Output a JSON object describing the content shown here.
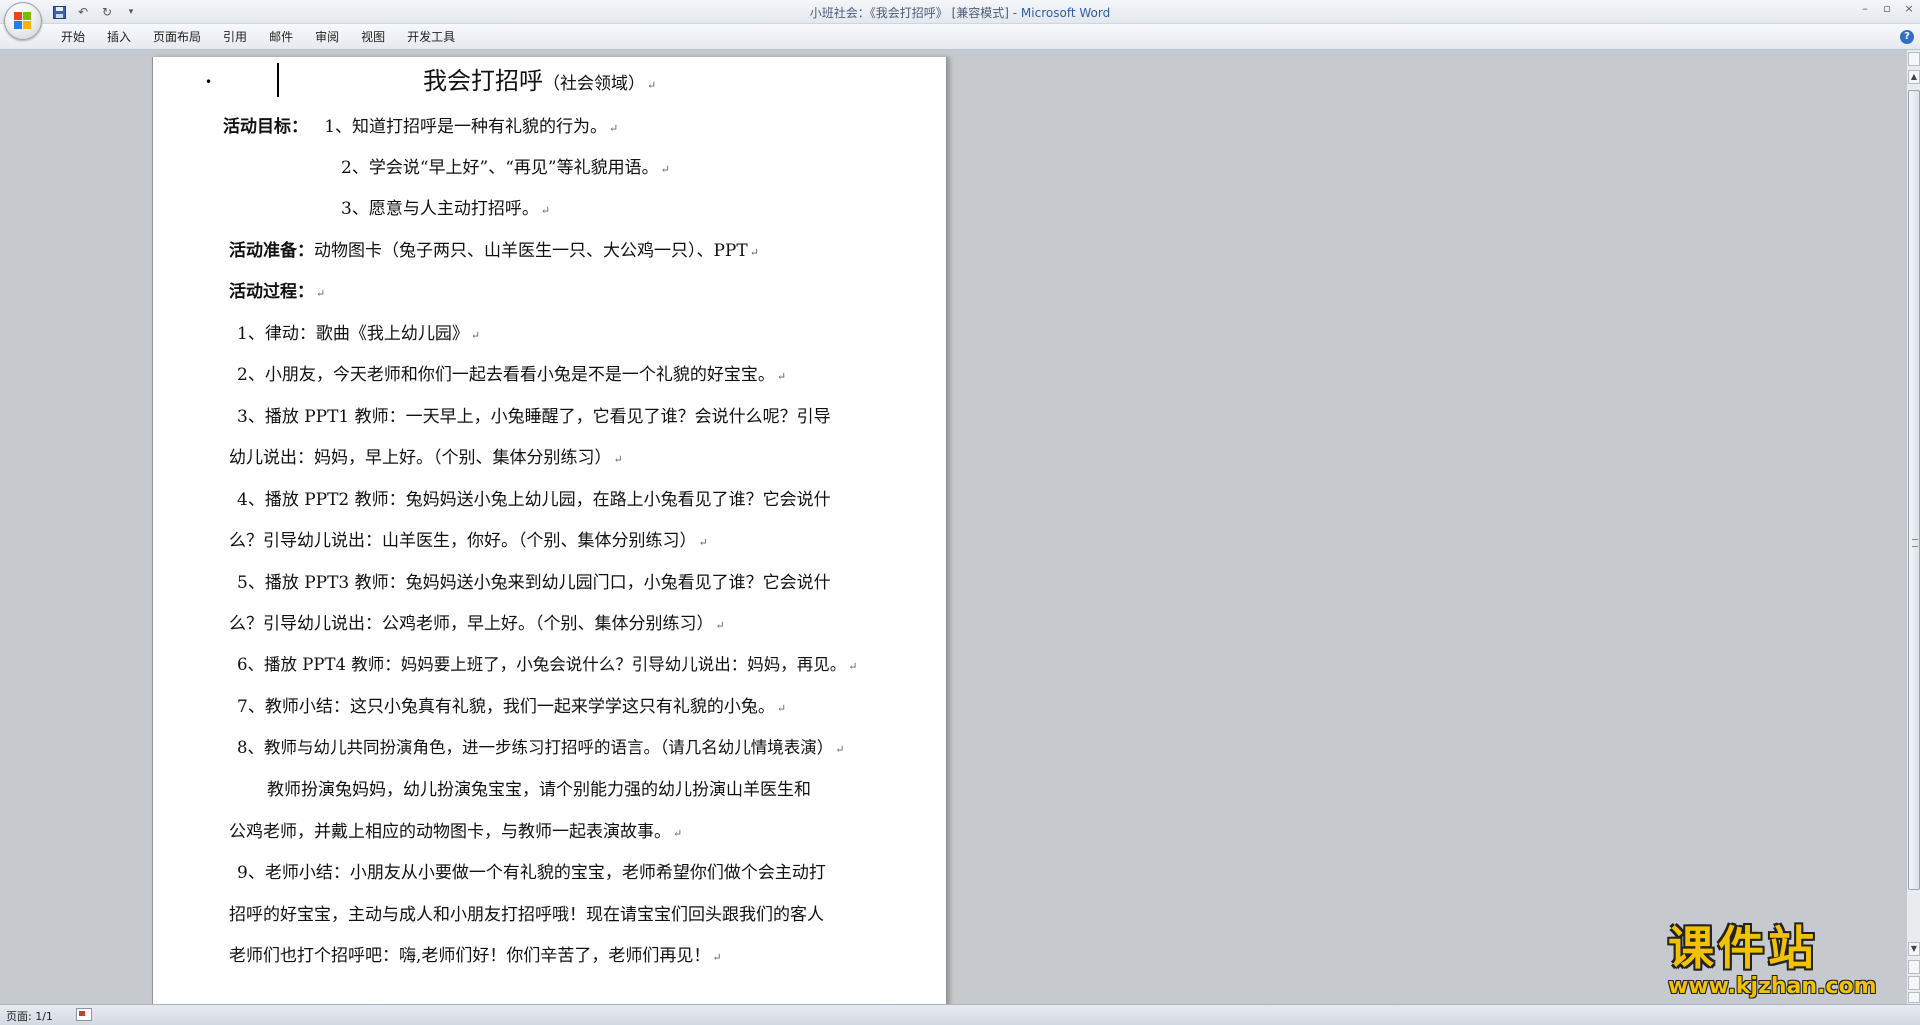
{
  "window": {
    "title_doc": "小班社会：《我会打招呼》 [兼容模式] - ",
    "title_app": "Microsoft Word",
    "controls": [
      "–",
      "▫",
      "×"
    ]
  },
  "qat": {
    "undo": "↶",
    "redo": "↻",
    "dropdown": "▾"
  },
  "ribbon": {
    "tabs": [
      "开始",
      "插入",
      "页面布局",
      "引用",
      "邮件",
      "审阅",
      "视图",
      "开发工具"
    ],
    "help": "?"
  },
  "document": {
    "title": "我会打招呼",
    "title_sub": "（社会领域）",
    "bullet": "•",
    "para_mark": "↵",
    "goals_label": "活动目标：",
    "goals": [
      "1、知道打招呼是一种有礼貌的行为。",
      "2、学会说“早上好”、“再见”等礼貌用语。",
      "3、愿意与人主动打招呼。"
    ],
    "prep_label": "活动准备：",
    "prep_text": "动物图卡（兔子两只、山羊医生一只、大公鸡一只）、PPT",
    "process_label": "活动过程：",
    "lines": [
      "1、律动：歌曲《我上幼儿园》",
      "2、小朋友，今天老师和你们一起去看看小兔是不是一个礼貌的好宝宝。",
      "3、播放 PPT1 教师：一天早上，小兔睡醒了，它看见了谁？会说什么呢？引导",
      "幼儿说出：妈妈，早上好。（个别、集体分别练习）",
      "4、播放 PPT2 教师：兔妈妈送小兔上幼儿园，在路上小兔看见了谁？它会说什",
      "么？引导幼儿说出：山羊医生，你好。（个别、集体分别练习）",
      "5、播放 PPT3 教师：兔妈妈送小兔来到幼儿园门口，小兔看见了谁？它会说什",
      "么？引导幼儿说出：公鸡老师，早上好。（个别、集体分别练习）",
      "6、播放 PPT4 教师：妈妈要上班了，小兔会说什么？引导幼儿说出：妈妈，再见。",
      "7、教师小结：这只小兔真有礼貌，我们一起来学学这只有礼貌的小兔。",
      "8、教师与幼儿共同扮演角色，进一步练习打招呼的语言。（请几名幼儿情境表演）",
      "教师扮演兔妈妈，幼儿扮演兔宝宝，请个别能力强的幼儿扮演山羊医生和",
      "公鸡老师，并戴上相应的动物图卡，与教师一起表演故事。",
      "9、老师小结：小朋友从小要做一个有礼貌的宝宝，老师希望你们做个会主动打",
      "招呼的好宝宝，主动与成人和小朋友打招呼哦！现在请宝宝们回头跟我们的客人",
      "老师们也打个招呼吧：嗨,老师们好！你们辛苦了，老师们再见！"
    ]
  },
  "scrollbar": {
    "up": "▲",
    "down": "▼"
  },
  "status": {
    "page": "页面: 1/1"
  },
  "watermark": {
    "main": "课件站",
    "url": "www.kjzhan.com"
  }
}
